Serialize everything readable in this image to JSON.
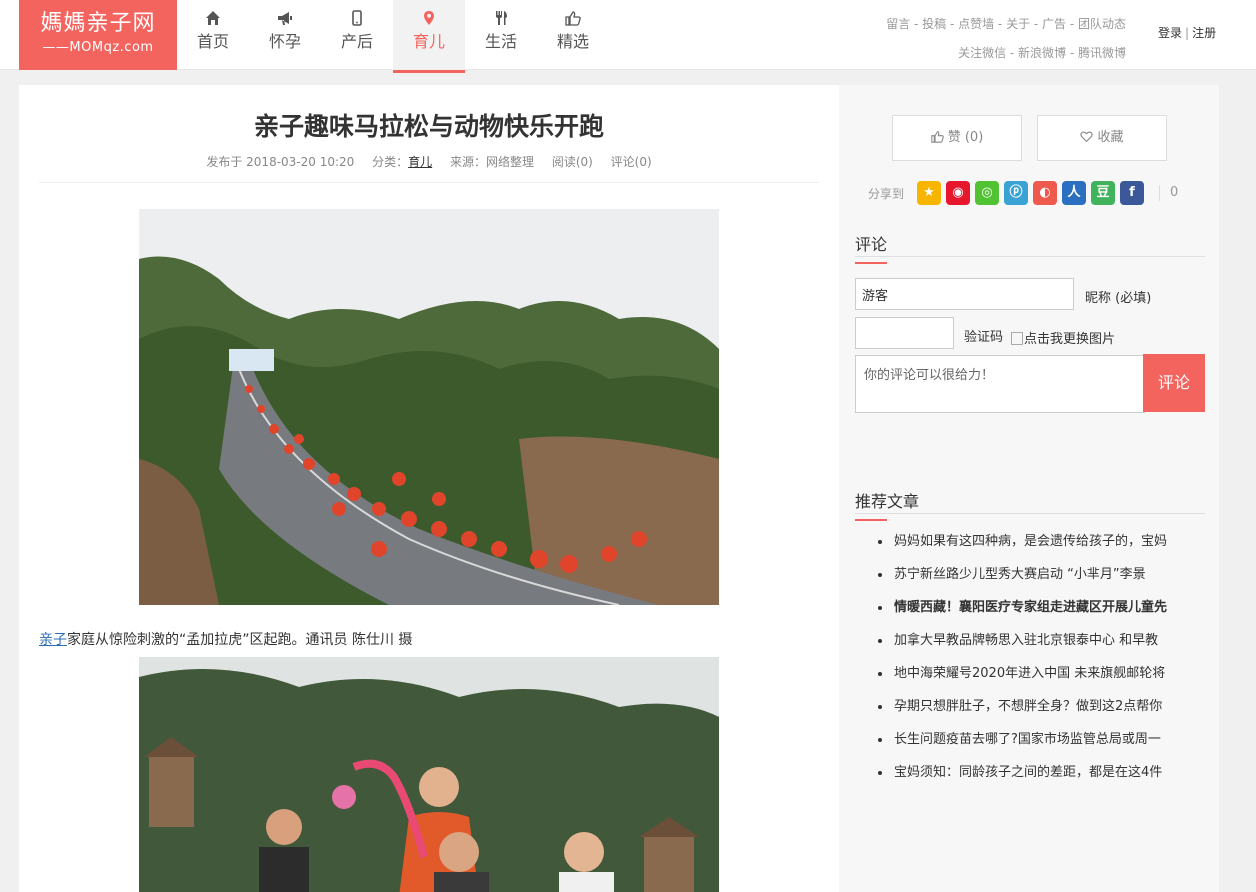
{
  "logo": {
    "line1": "媽媽亲子网",
    "line2": "——MOMqz.com"
  },
  "nav": [
    {
      "label": "首页",
      "icon": "home-icon"
    },
    {
      "label": "怀孕",
      "icon": "megaphone-icon"
    },
    {
      "label": "产后",
      "icon": "phone-icon"
    },
    {
      "label": "育儿",
      "icon": "location-pin-icon",
      "active": true
    },
    {
      "label": "生活",
      "icon": "fork-knife-icon"
    },
    {
      "label": "精选",
      "icon": "thumbs-up-icon"
    }
  ],
  "toplinks": {
    "row1": "留言 - 投稿 - 点赞墙 - 关于 - 广告 - 团队动态",
    "row2": "关注微信 - 新浪微博 - 腾讯微博"
  },
  "auth": {
    "login": "登录",
    "separator": "|",
    "register": "注册"
  },
  "article": {
    "title": "亲子趣味马拉松与动物快乐开跑",
    "published": "发布于 2018-03-20 10:20",
    "category_label": "分类：",
    "category": "育儿",
    "source": "来源：网络整理",
    "reads": "阅读(0)",
    "comments": "评论(0)",
    "caption_link": "亲子",
    "caption_text": "家庭从惊险刺激的“孟加拉虎”区起跑。通讯员 陈仕川 摄"
  },
  "sidebar": {
    "like_label": "赞 (0)",
    "favorite_label": "收藏",
    "share_label": "分享到",
    "share_count": "0",
    "share_icons": [
      {
        "name": "qzone-icon",
        "glyph": "★",
        "color": "#f7b500"
      },
      {
        "name": "weibo-icon",
        "glyph": "◉",
        "color": "#e6162d"
      },
      {
        "name": "wechat-icon",
        "glyph": "◎",
        "color": "#51c332"
      },
      {
        "name": "tencent-weibo-icon",
        "glyph": "ⓟ",
        "color": "#3ba3d4"
      },
      {
        "name": "qq-icon",
        "glyph": "◐",
        "color": "#ef5a4f"
      },
      {
        "name": "renren-icon",
        "glyph": "人",
        "color": "#2b6fc1"
      },
      {
        "name": "douban-icon",
        "glyph": "豆",
        "color": "#41b35d"
      },
      {
        "name": "facebook-icon",
        "glyph": "f",
        "color": "#3b5998"
      }
    ],
    "comment_title": "评论",
    "nickname_value": "游客",
    "nickname_label": "昵称 (必填)",
    "captcha_label": "验证码",
    "captcha_image_alt": "点击我更换图片",
    "comment_placeholder": "你的评论可以很给力！",
    "submit_label": "评论",
    "recommend_title": "推荐文章",
    "recommend": [
      {
        "text": "妈妈如果有这四种病，是会遗传给孩子的，宝妈",
        "bold": false
      },
      {
        "text": "苏宁新丝路少儿型秀大赛启动 “小芈月”李景",
        "bold": false
      },
      {
        "text": "情暖西藏！襄阳医疗专家组走进藏区开展儿童先",
        "bold": true
      },
      {
        "text": "加拿大早教品牌畅思入驻北京银泰中心 和早教",
        "bold": false
      },
      {
        "text": "地中海荣耀号2020年进入中国 未来旗舰邮轮将",
        "bold": false
      },
      {
        "text": "孕期只想胖肚子，不想胖全身？做到这2点帮你",
        "bold": false
      },
      {
        "text": "长生问题疫苗去哪了?国家市场监管总局或周一",
        "bold": false
      },
      {
        "text": "宝妈须知：同龄孩子之间的差距，都是在这4件",
        "bold": false
      }
    ]
  }
}
